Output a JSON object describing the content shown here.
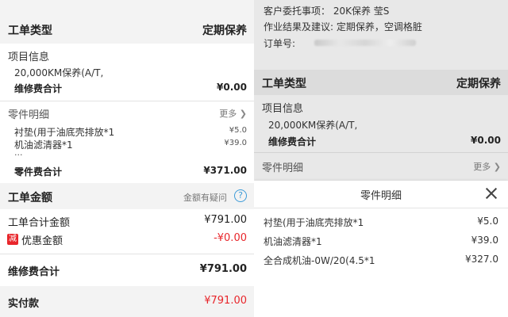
{
  "left": {
    "work_order_type": {
      "label": "工单类型",
      "value": "定期保养"
    },
    "project_info": {
      "title": "项目信息",
      "item": "20,000KM保养(A/T,",
      "total_label": "维修费合计",
      "total_value": "¥0.00"
    },
    "parts": {
      "title": "零件明细",
      "more": "更多",
      "items": [
        "衬垫(用于油底壳排放*1",
        "机油滤清器*1"
      ],
      "item_prices": [
        "¥5.0",
        "¥39.0"
      ],
      "ellipsis": "...",
      "total_label": "零件费合计",
      "total_value": "¥371.00"
    },
    "amount": {
      "title": "工单金额",
      "question": "金额有疑问",
      "question_icon": "?",
      "order_total_label": "工单合计金额",
      "order_total_value": "¥791.00",
      "discount_icon": "减",
      "discount_label": "优惠金额",
      "discount_value": "-¥0.00",
      "repair_total_label": "维修费合计",
      "repair_total_value": "¥791.00",
      "paid_label": "实付款",
      "paid_value": "¥791.00"
    }
  },
  "right": {
    "customer_request": "客户委托事项：  20K保养 莹S",
    "result_suggestion": "作业结果及建议:      定期保养，空调格脏",
    "order_no_label": "订单号:",
    "work_order_type": {
      "label": "工单类型",
      "value": "定期保养"
    },
    "project_info": {
      "title": "项目信息",
      "item": "20,000KM保养(A/T,",
      "total_label": "维修费合计",
      "total_value": "¥0.00"
    },
    "parts": {
      "title": "零件明细",
      "more": "更多"
    },
    "modal": {
      "title": "零件明细",
      "items": [
        {
          "name": "衬垫(用于油底壳排放*1",
          "price": "¥5.0"
        },
        {
          "name": "机油滤清器*1",
          "price": "¥39.0"
        },
        {
          "name": "全合成机油-0W/20(4.5*1",
          "price": "¥327.0"
        }
      ]
    }
  },
  "colors": {
    "red": "#e8262b",
    "link_blue": "#3c9bd8",
    "grey_bg": "#f3f3f3"
  }
}
